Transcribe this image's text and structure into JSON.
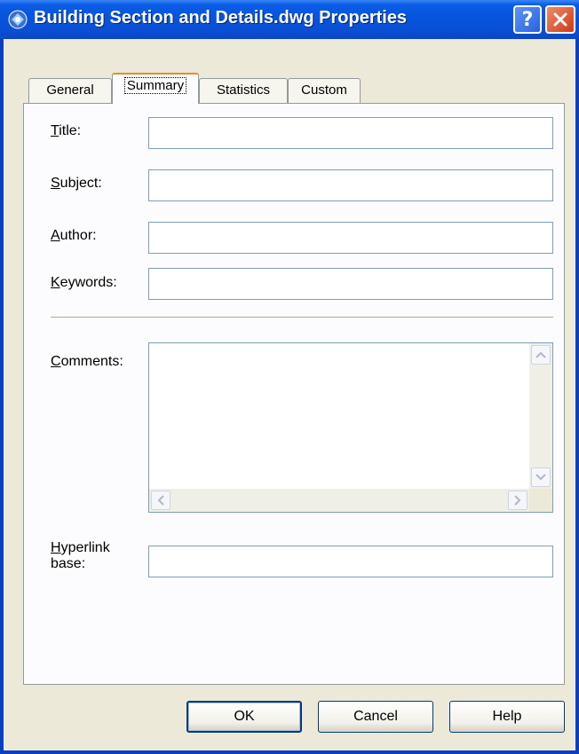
{
  "window": {
    "title": "Building Section and Details.dwg Properties",
    "help_glyph": "?",
    "close_glyph": "✕"
  },
  "tabs": [
    {
      "label": "General"
    },
    {
      "label": "Summary",
      "active": true
    },
    {
      "label": "Statistics"
    },
    {
      "label": "Custom"
    }
  ],
  "fields": {
    "title": {
      "label": "Title:",
      "mnemonic": "T",
      "value": ""
    },
    "subject": {
      "label": "Subject:",
      "mnemonic": "S",
      "value": ""
    },
    "author": {
      "label": "Author:",
      "mnemonic": "A",
      "value": ""
    },
    "keywords": {
      "label": "Keywords:",
      "mnemonic": "K",
      "value": ""
    },
    "comments": {
      "label": "Comments:",
      "mnemonic": "C",
      "value": ""
    },
    "hyperlink_base": {
      "label_line1": "Hyperlink",
      "label_line2": "base:",
      "mnemonic": "H",
      "value": ""
    }
  },
  "buttons": {
    "ok": "OK",
    "cancel": "Cancel",
    "help": "Help"
  },
  "colors": {
    "titlebar": "#0a5ce6",
    "dialog_bg": "#ece9d8",
    "tab_accent": "#e68b2c",
    "close_button": "#cf3a16"
  },
  "icons": [
    "app-icon",
    "help-icon",
    "close-icon",
    "scroll-up-icon",
    "scroll-down-icon",
    "scroll-left-icon",
    "scroll-right-icon"
  ]
}
